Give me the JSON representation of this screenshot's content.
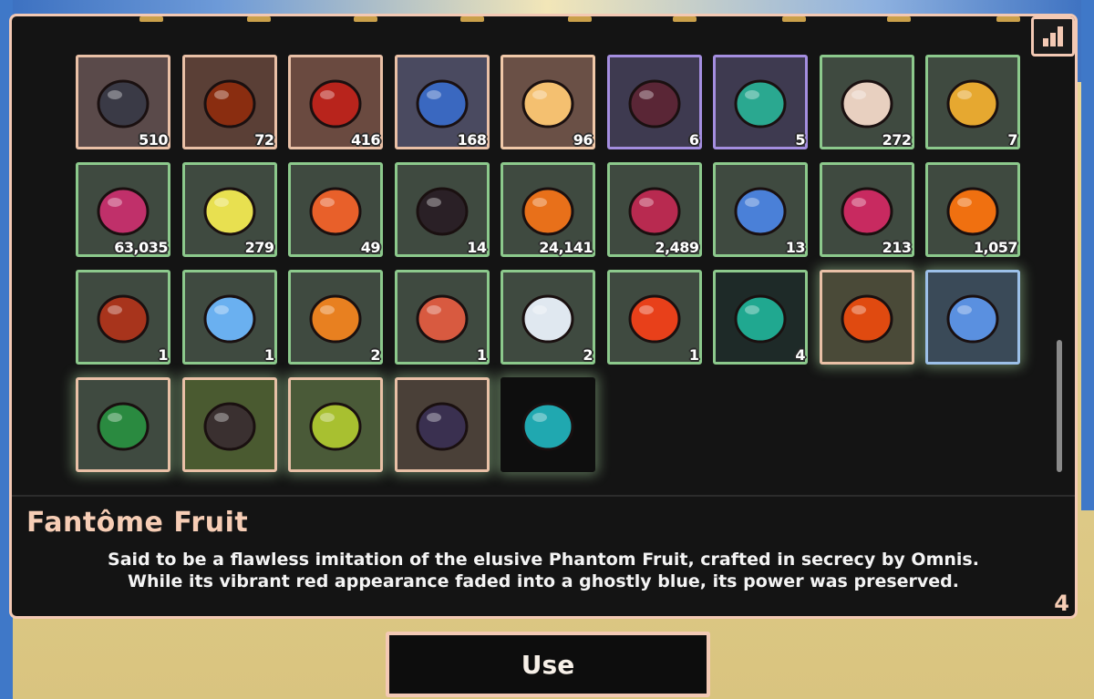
{
  "inventory": {
    "items": [
      {
        "count": "510",
        "icon": "dark-orb",
        "tint": "#5a4a4a",
        "border": "#e9c0a6",
        "art": "#3a3a46"
      },
      {
        "count": "72",
        "icon": "flame-crate",
        "tint": "#5a3f36",
        "border": "#e9c0a6",
        "art": "#8a2d10"
      },
      {
        "count": "416",
        "icon": "red-gem",
        "tint": "#6a4a40",
        "border": "#e9c0a6",
        "art": "#b8241c"
      },
      {
        "count": "168",
        "icon": "star-shard",
        "tint": "#4a4a60",
        "border": "#e9c0a6",
        "art": "#3a68c0"
      },
      {
        "count": "96",
        "icon": "gold-star",
        "tint": "#6a5046",
        "border": "#f0c8a8",
        "art": "#f4c070"
      },
      {
        "count": "6",
        "icon": "dark-relic",
        "tint": "#3e3a50",
        "border": "#a48ee0",
        "art": "#5a2636"
      },
      {
        "count": "5",
        "icon": "emerald-chest",
        "tint": "#3e3a50",
        "border": "#a48ee0",
        "art": "#2aa890"
      },
      {
        "count": "272",
        "icon": "feather-horn",
        "tint": "#3f4a40",
        "border": "#8cc98c",
        "art": "#e8d0c0"
      },
      {
        "count": "7",
        "icon": "rubber-duck",
        "tint": "#3f4a40",
        "border": "#8cc98c",
        "art": "#e6a830"
      },
      {
        "count": "63,035",
        "icon": "pink-fruit",
        "tint": "#3f4a40",
        "border": "#8cc98c",
        "art": "#c0306a"
      },
      {
        "count": "279",
        "icon": "yellow-eye",
        "tint": "#3f4a40",
        "border": "#8cc98c",
        "art": "#e8e050"
      },
      {
        "count": "49",
        "icon": "carrot",
        "tint": "#3f4a40",
        "border": "#8cc98c",
        "art": "#e8602a"
      },
      {
        "count": "14",
        "icon": "dark-pod",
        "tint": "#3f4a40",
        "border": "#8cc98c",
        "art": "#2a2026"
      },
      {
        "count": "24,141",
        "icon": "orange-fruit",
        "tint": "#3f4a40",
        "border": "#8cc98c",
        "art": "#e8701a"
      },
      {
        "count": "2,489",
        "icon": "magenta-fruit",
        "tint": "#3f4a40",
        "border": "#8cc98c",
        "art": "#b82a50"
      },
      {
        "count": "13",
        "icon": "blue-crystal",
        "tint": "#3f4a40",
        "border": "#8cc98c",
        "art": "#4a80d8"
      },
      {
        "count": "213",
        "icon": "crimson-crystal",
        "tint": "#3f4a40",
        "border": "#8cc98c",
        "art": "#c82a60"
      },
      {
        "count": "1,057",
        "icon": "flame-crystal",
        "tint": "#3f4a40",
        "border": "#8cc98c",
        "art": "#f07010"
      },
      {
        "count": "1",
        "icon": "ember-orb",
        "tint": "#3f4a40",
        "border": "#8cc98c",
        "art": "#a8341c"
      },
      {
        "count": "1",
        "icon": "ice-apple",
        "tint": "#3f4a40",
        "border": "#8cc98c",
        "art": "#6ab0f0"
      },
      {
        "count": "2",
        "icon": "pudding",
        "tint": "#3f4a40",
        "border": "#8cc98c",
        "art": "#e88020"
      },
      {
        "count": "1",
        "icon": "paw-cake",
        "tint": "#3f4a40",
        "border": "#8cc98c",
        "art": "#d85a40"
      },
      {
        "count": "2",
        "icon": "cake-slice",
        "tint": "#3f4a40",
        "border": "#8cc98c",
        "art": "#e0e8f0"
      },
      {
        "count": "1",
        "icon": "red-apple",
        "tint": "#3f4a40",
        "border": "#8cc98c",
        "art": "#e8401a"
      },
      {
        "count": "4",
        "icon": "teal-heart",
        "tint": "#1e2a28",
        "border": "#8cc98c",
        "art": "#20a890"
      },
      {
        "count": "",
        "icon": "sparkle-star-fruit",
        "tint": "#4a4a38",
        "border": "#e9c0a6",
        "art": "#e04a10"
      },
      {
        "count": "",
        "icon": "ice-star-fruit",
        "tint": "#3a4a58",
        "border": "#9cc0e8",
        "art": "#5a90e0"
      },
      {
        "count": "",
        "icon": "leaf-blade-fruit",
        "tint": "#3f4a40",
        "border": "#e9c0a6",
        "art": "#2a8a40"
      },
      {
        "count": "",
        "icon": "moss-fruit",
        "tint": "#4a5a30",
        "border": "#e9c0a6",
        "art": "#3a3030"
      },
      {
        "count": "",
        "icon": "lime-fruit",
        "tint": "#4a5a38",
        "border": "#e9c0a6",
        "art": "#a8c030"
      },
      {
        "count": "",
        "icon": "cocoa-fruit",
        "tint": "#4a4038",
        "border": "#e9c0a6",
        "art": "#3a3050"
      },
      {
        "count": "",
        "icon": "phantom-eye-fruit",
        "tint": "#0e0e0e",
        "border": "#0e0e0e",
        "art": "#20a8b0"
      }
    ]
  },
  "details": {
    "name": "Fantôme Fruit",
    "description_line1": "Said to be a flawless imitation of the elusive Phantom Fruit, crafted in secrecy by Omnis.",
    "description_line2": "While its vibrant red appearance faded into a ghostly blue, its power was preserved.",
    "owned": "4"
  },
  "actions": {
    "use_label": "Use"
  }
}
